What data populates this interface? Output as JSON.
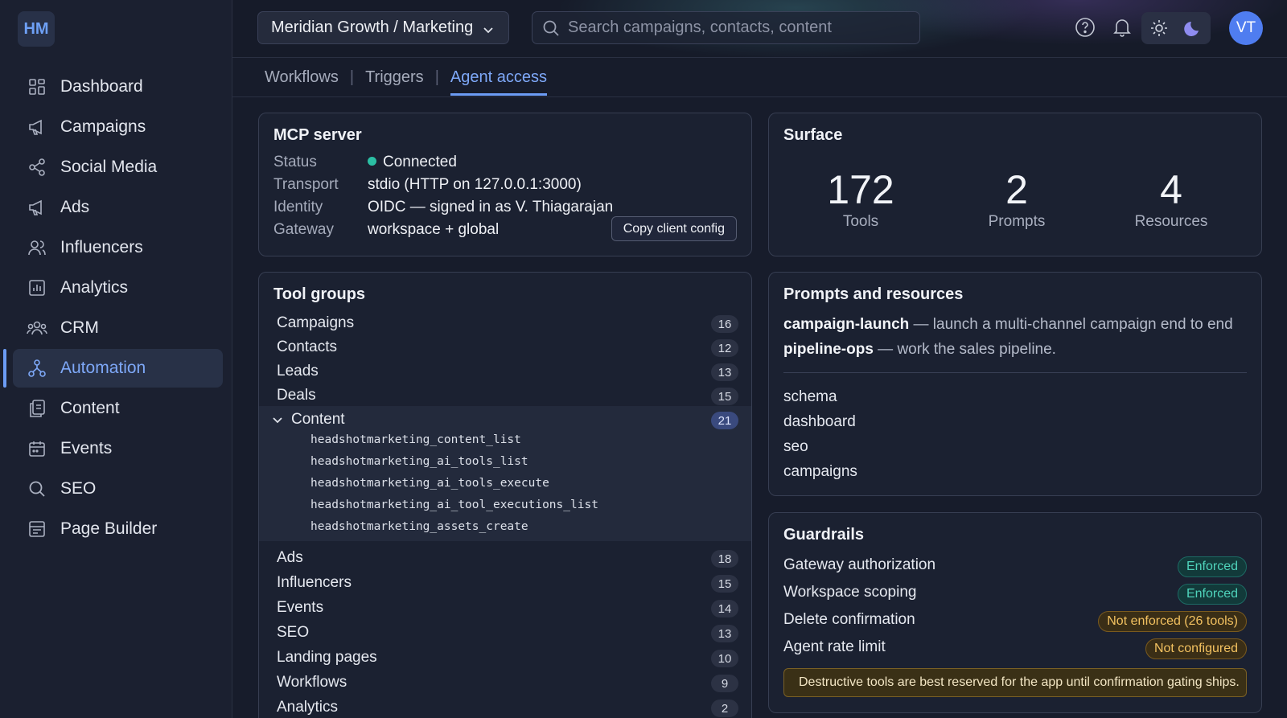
{
  "app": {
    "logo": "HM"
  },
  "sidebar": {
    "items": [
      {
        "label": "Dashboard",
        "icon": "dashboard-icon"
      },
      {
        "label": "Campaigns",
        "icon": "megaphone-icon"
      },
      {
        "label": "Social Media",
        "icon": "share-icon"
      },
      {
        "label": "Ads",
        "icon": "megaphone-icon"
      },
      {
        "label": "Influencers",
        "icon": "users-icon"
      },
      {
        "label": "Analytics",
        "icon": "chart-icon"
      },
      {
        "label": "CRM",
        "icon": "group-icon"
      },
      {
        "label": "Automation",
        "icon": "workflow-icon",
        "active": true
      },
      {
        "label": "Content",
        "icon": "documents-icon"
      },
      {
        "label": "Events",
        "icon": "calendar-icon"
      },
      {
        "label": "SEO",
        "icon": "search-icon"
      },
      {
        "label": "Page Builder",
        "icon": "layout-icon"
      }
    ]
  },
  "header": {
    "workspace": "Meridian Growth / Marketing",
    "search_placeholder": "Search campaigns, contacts, content",
    "avatar": "VT"
  },
  "tabs": [
    "Workflows",
    "Triggers",
    "Agent access"
  ],
  "active_tab": "Agent access",
  "mcp": {
    "title": "MCP server",
    "rows": [
      {
        "key": "Status",
        "value": "Connected"
      },
      {
        "key": "Transport",
        "value": "stdio (HTTP on 127.0.0.1:3000)"
      },
      {
        "key": "Identity",
        "value": "OIDC — signed in as V. Thiagarajan"
      },
      {
        "key": "Gateway",
        "value": "workspace + global"
      }
    ],
    "copy_label": "Copy client config",
    "status_color": "#2bbfa4"
  },
  "surface": {
    "title": "Surface",
    "stats": [
      {
        "num": "172",
        "label": "Tools"
      },
      {
        "num": "2",
        "label": "Prompts"
      },
      {
        "num": "4",
        "label": "Resources"
      }
    ]
  },
  "tool_groups": {
    "title": "Tool groups",
    "before": [
      {
        "name": "Campaigns",
        "count": "16"
      },
      {
        "name": "Contacts",
        "count": "12"
      },
      {
        "name": "Leads",
        "count": "13"
      },
      {
        "name": "Deals",
        "count": "15"
      }
    ],
    "expanded": {
      "name": "Content",
      "count": "21",
      "tools": [
        "headshotmarketing_content_list",
        "headshotmarketing_ai_tools_list",
        "headshotmarketing_ai_tools_execute",
        "headshotmarketing_ai_tool_executions_list",
        "headshotmarketing_assets_create"
      ]
    },
    "after": [
      {
        "name": "Ads",
        "count": "18"
      },
      {
        "name": "Influencers",
        "count": "15"
      },
      {
        "name": "Events",
        "count": "14"
      },
      {
        "name": "SEO",
        "count": "13"
      },
      {
        "name": "Landing pages",
        "count": "10"
      },
      {
        "name": "Workflows",
        "count": "9"
      },
      {
        "name": "Analytics",
        "count": "2"
      }
    ]
  },
  "prompts_resources": {
    "title": "Prompts and resources",
    "prompts": [
      {
        "name": "campaign-launch",
        "desc": " — launch a multi-channel campaign end to end"
      },
      {
        "name": "pipeline-ops",
        "desc": " — work the sales pipeline."
      }
    ],
    "resources": [
      "schema",
      "dashboard",
      "seo",
      "campaigns"
    ]
  },
  "guardrails": {
    "title": "Guardrails",
    "rows": [
      {
        "label": "Gateway authorization",
        "status": "Enforced",
        "tone": "ok"
      },
      {
        "label": "Workspace scoping",
        "status": "Enforced",
        "tone": "ok"
      },
      {
        "label": "Delete confirmation",
        "status": "Not enforced (26 tools)",
        "tone": "warn"
      },
      {
        "label": "Agent rate limit",
        "status": "Not configured",
        "tone": "warn"
      }
    ],
    "note": "Destructive tools are best reserved for the app until confirmation gating ships."
  },
  "colors": {
    "accent": "#6c9cf5",
    "ok": "#4fd3bb",
    "warn": "#f2c160"
  }
}
